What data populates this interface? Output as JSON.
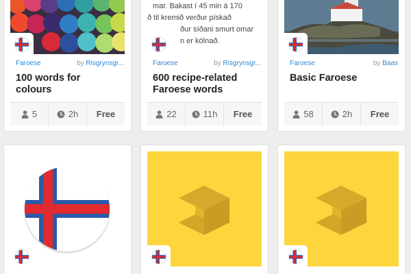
{
  "courses": [
    {
      "language": "Faroese",
      "by": "by",
      "author": "Risgrynsgr...",
      "title": "100 words for colours",
      "learners": "5",
      "duration": "2h",
      "price": "Free"
    },
    {
      "language": "Faroese",
      "by": "by",
      "author": "Risgrynsgr...",
      "title": "600 recipe-related Faroese words",
      "learners": "22",
      "duration": "11h",
      "price": "Free",
      "image_text": [
        "mar. Bakast í 45 min á 170",
        "ð til kremið verður pískað",
        "ður síðani smurt omar",
        "n er kólnað."
      ]
    },
    {
      "language": "Faroese",
      "by": "by",
      "author": "Baas",
      "title": "Basic Faroese",
      "learners": "58",
      "duration": "2h",
      "price": "Free"
    },
    {},
    {},
    {}
  ],
  "icons": {
    "learners": "person-icon",
    "duration": "clock-icon",
    "flag": "faroe-flag-icon",
    "placeholder": "memrise-logo-icon"
  },
  "colors": {
    "link": "#2e86d6",
    "placeholder_bg": "#fdd53d",
    "flag_red": "#e12b2f",
    "flag_blue": "#2a5aa8"
  }
}
